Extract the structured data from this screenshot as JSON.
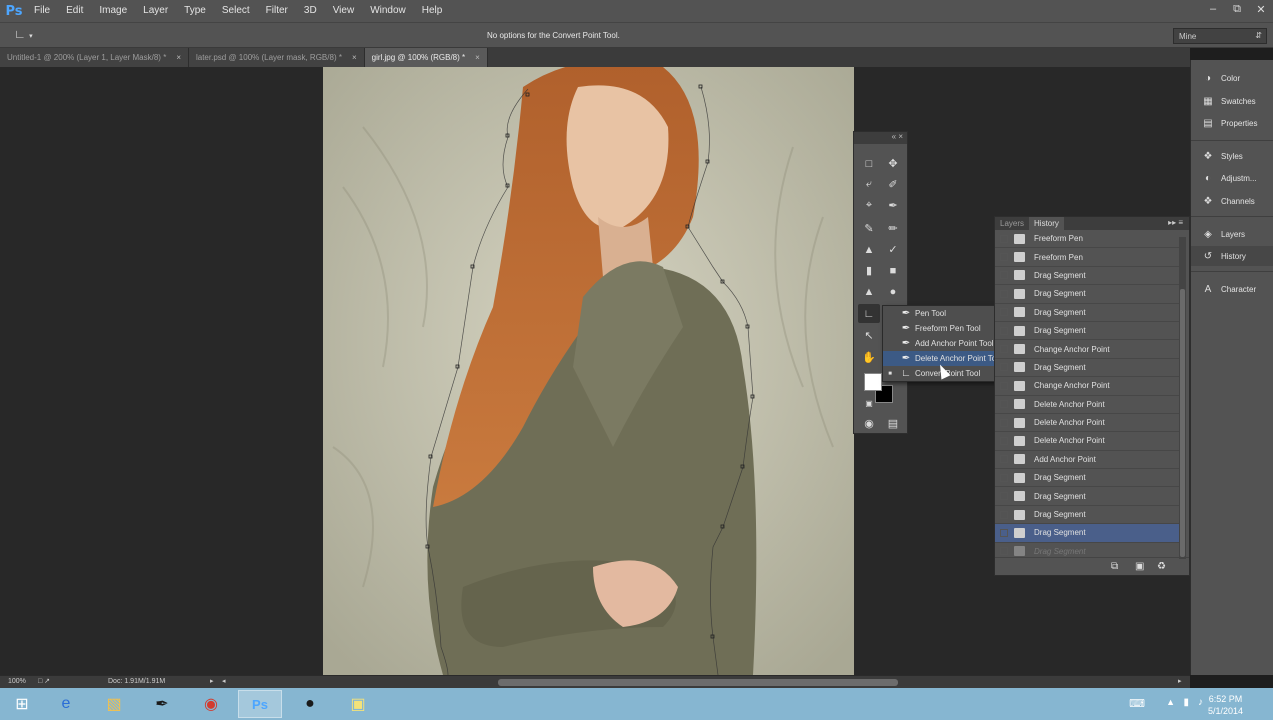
{
  "app": {
    "logo": "Ps"
  },
  "menu": [
    "File",
    "Edit",
    "Image",
    "Layer",
    "Type",
    "Select",
    "Filter",
    "3D",
    "View",
    "Window",
    "Help"
  ],
  "window_controls": [
    "minimize-icon",
    "restore-icon",
    "close-icon"
  ],
  "options_bar": {
    "message": "No options for the Convert Point Tool.",
    "workspace": "Mine"
  },
  "doc_tabs": [
    {
      "label": "Untitled-1 @ 200% (Layer 1, Layer Mask/8) *",
      "active": false
    },
    {
      "label": "later.psd @ 100% (Layer mask, RGB/8) *",
      "active": false
    },
    {
      "label": "girl.jpg @ 100% (RGB/8) *",
      "active": true
    }
  ],
  "status": {
    "zoom": "100%",
    "doc_info": "Doc: 1.91M/1.91M"
  },
  "flyout": {
    "items": [
      {
        "label": "Pen Tool",
        "key": "P",
        "icon": "pen-icon"
      },
      {
        "label": "Freeform Pen Tool",
        "key": "P",
        "icon": "freeform-pen-icon"
      },
      {
        "label": "Add Anchor Point Tool",
        "key": "",
        "icon": "add-anchor-icon"
      },
      {
        "label": "Delete Anchor Point Tool",
        "key": "",
        "icon": "delete-anchor-icon"
      },
      {
        "label": "Convert Point Tool",
        "key": "",
        "icon": "convert-point-icon"
      }
    ]
  },
  "history": {
    "tabs": [
      "Layers",
      "History"
    ],
    "active_tab": "History",
    "items": [
      "Freeform Pen",
      "Freeform Pen",
      "Drag Segment",
      "Drag Segment",
      "Drag Segment",
      "Drag Segment",
      "Change Anchor Point",
      "Drag Segment",
      "Change Anchor Point",
      "Delete Anchor Point",
      "Delete Anchor Point",
      "Delete Anchor Point",
      "Add Anchor Point",
      "Drag Segment",
      "Drag Segment",
      "Drag Segment",
      "Drag Segment",
      "Drag Segment"
    ]
  },
  "dock": {
    "items": [
      "Color",
      "Swatches",
      "Properties",
      "Styles",
      "Adjustm...",
      "Channels",
      "Layers",
      "History",
      "Character"
    ]
  },
  "taskbar": {
    "time": "6:52 PM",
    "date": "5/1/2014"
  },
  "colors": {
    "selection": "#4a5f8a",
    "hover": "#3c5a85",
    "taskbar": "#86b6d1"
  }
}
